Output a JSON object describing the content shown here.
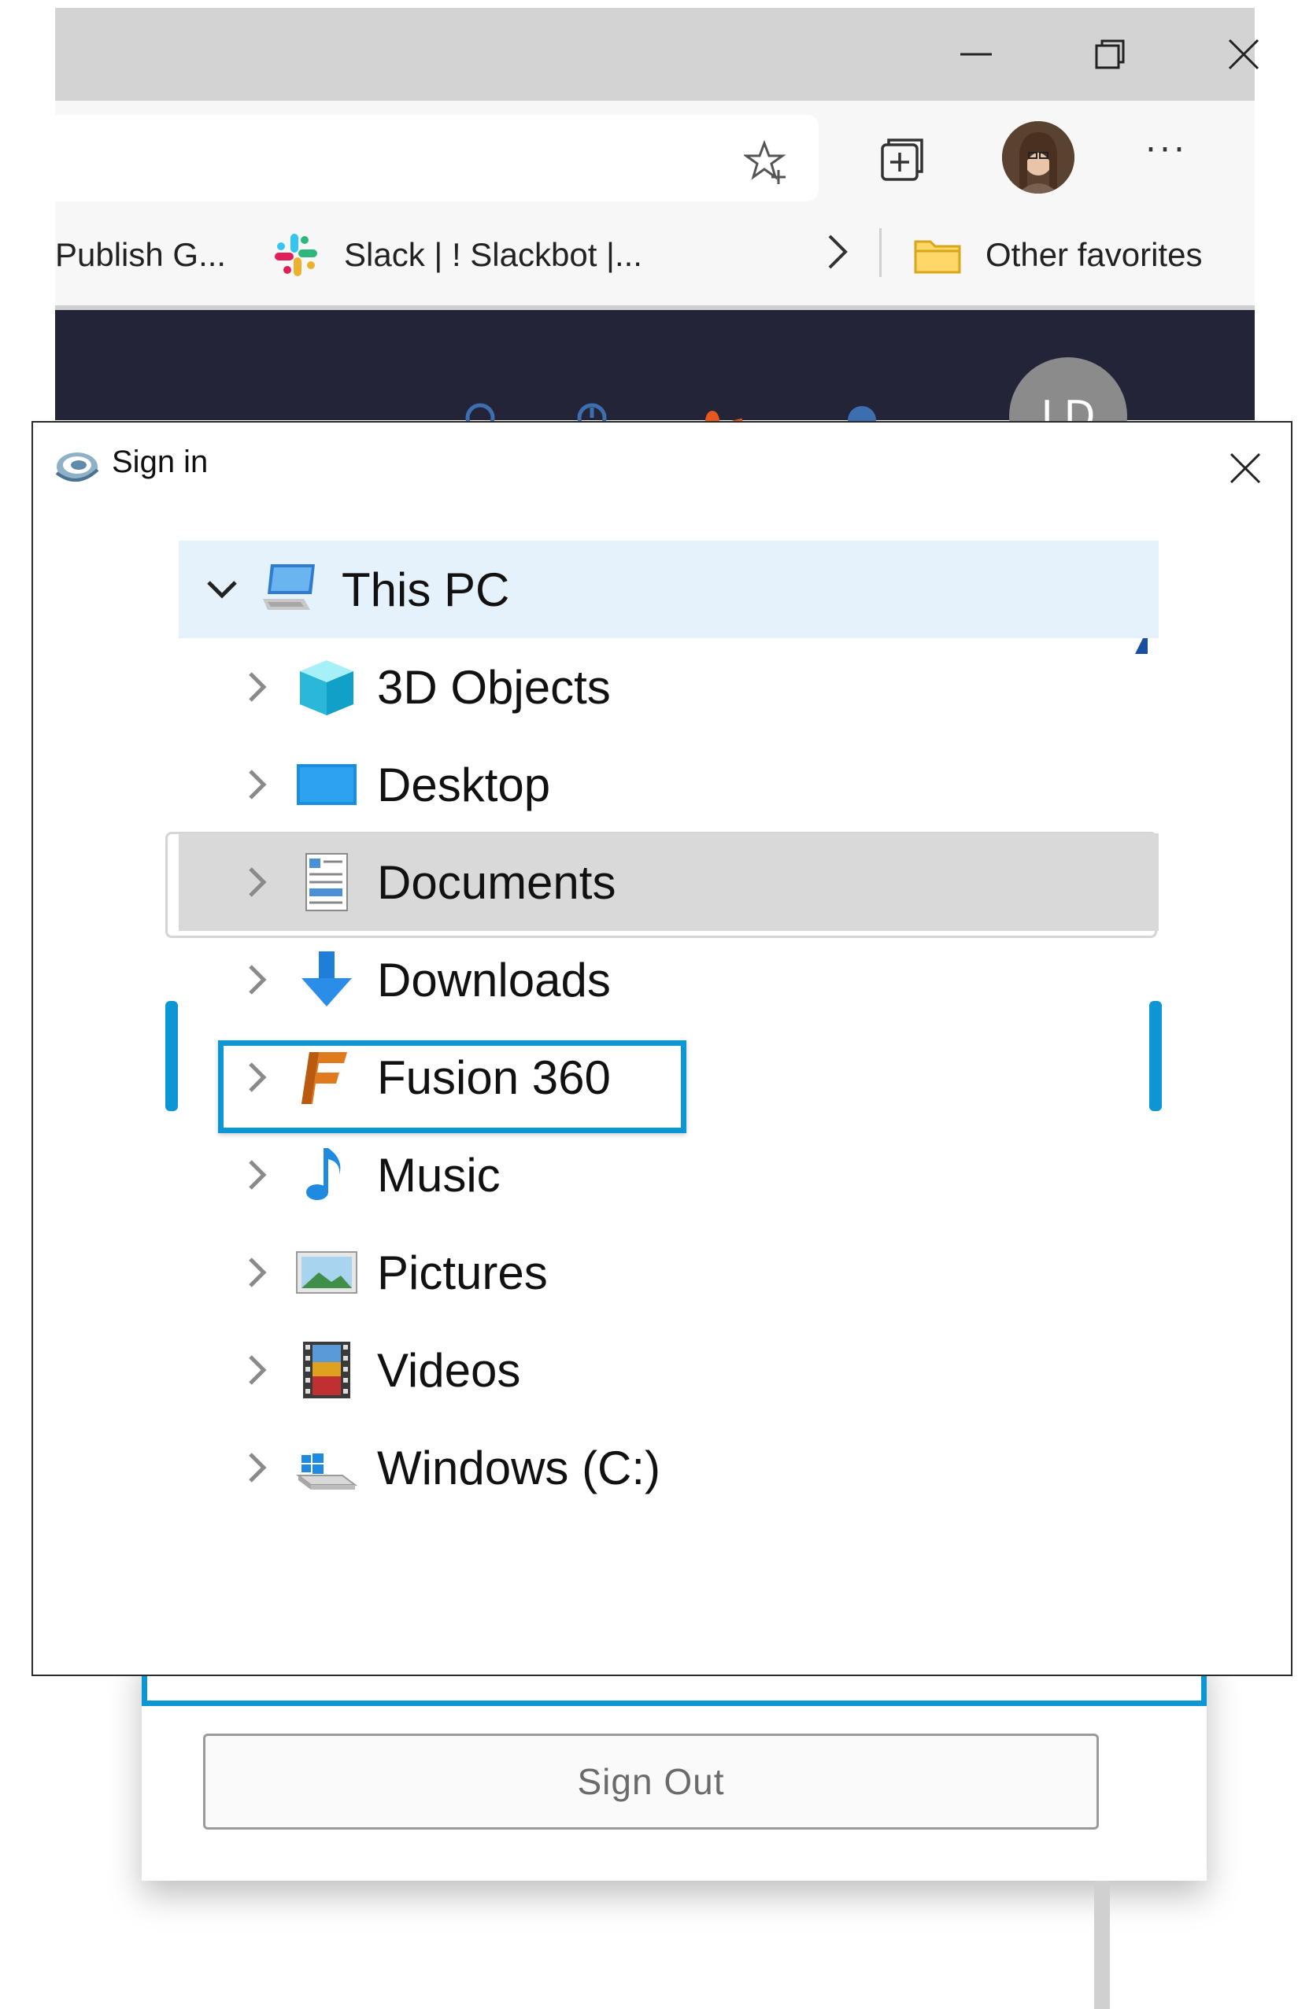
{
  "browser": {
    "window_controls": {
      "minimize": "minimize-icon",
      "maximize": "restore-icon",
      "close": "close-icon"
    },
    "favorites": [
      {
        "label": "Publish G...",
        "icon": ""
      },
      {
        "label": "Slack | ! Slackbot |...",
        "icon": "slack-icon"
      }
    ],
    "other_favorites": "Other favorites"
  },
  "app": {
    "user_initials": "LD",
    "sign_out_label": "Sign Out"
  },
  "dialog": {
    "title": "Sign in",
    "tree": {
      "root": {
        "label": "This PC",
        "icon": "computer-icon",
        "expanded": true
      },
      "children": [
        {
          "label": "3D Objects",
          "icon": "3d-objects-icon"
        },
        {
          "label": "Desktop",
          "icon": "desktop-icon"
        },
        {
          "label": "Documents",
          "icon": "documents-icon"
        },
        {
          "label": "Downloads",
          "icon": "downloads-icon"
        },
        {
          "label": "Fusion 360",
          "icon": "fusion360-icon"
        },
        {
          "label": "Music",
          "icon": "music-icon"
        },
        {
          "label": "Pictures",
          "icon": "pictures-icon"
        },
        {
          "label": "Videos",
          "icon": "videos-icon"
        },
        {
          "label": "Windows (C:)",
          "icon": "drive-icon"
        }
      ]
    }
  },
  "colors": {
    "highlight_blue": "#0d96d4",
    "app_header": "#232437",
    "selected_row": "#e5f1fb",
    "hover_row": "#d9d9d9"
  }
}
